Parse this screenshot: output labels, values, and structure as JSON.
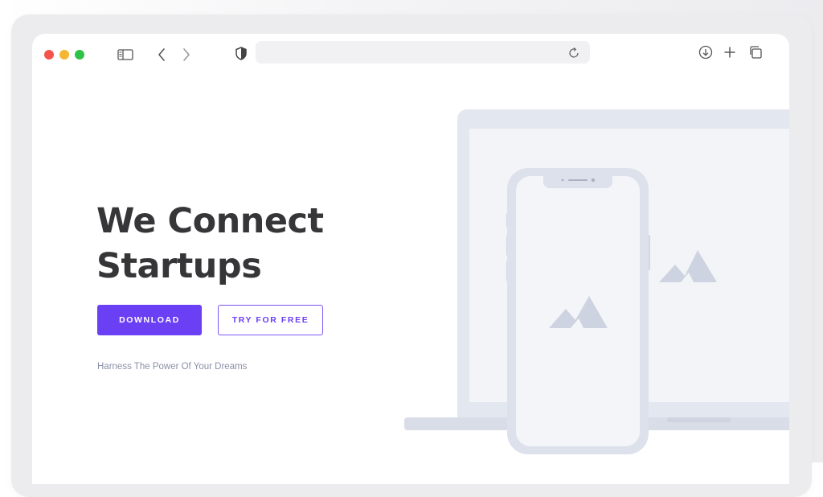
{
  "browser": {
    "url": "",
    "icons": [
      "sidebar-icon",
      "back-chevron-icon",
      "forward-chevron-icon",
      "shield-icon",
      "reload-icon",
      "download-icon",
      "plus-icon",
      "tabs-icon"
    ]
  },
  "hero": {
    "title_line1": "We Connect",
    "title_line2": "Startups",
    "primary_button": "DOWNLOAD",
    "secondary_button": "TRY FOR FREE",
    "tagline": "Harness The Power Of Your Dreams"
  },
  "colors": {
    "accent": "#6b3ff3",
    "title": "#363638",
    "tagline": "#8a90a8",
    "device": "#dfe3ee"
  }
}
